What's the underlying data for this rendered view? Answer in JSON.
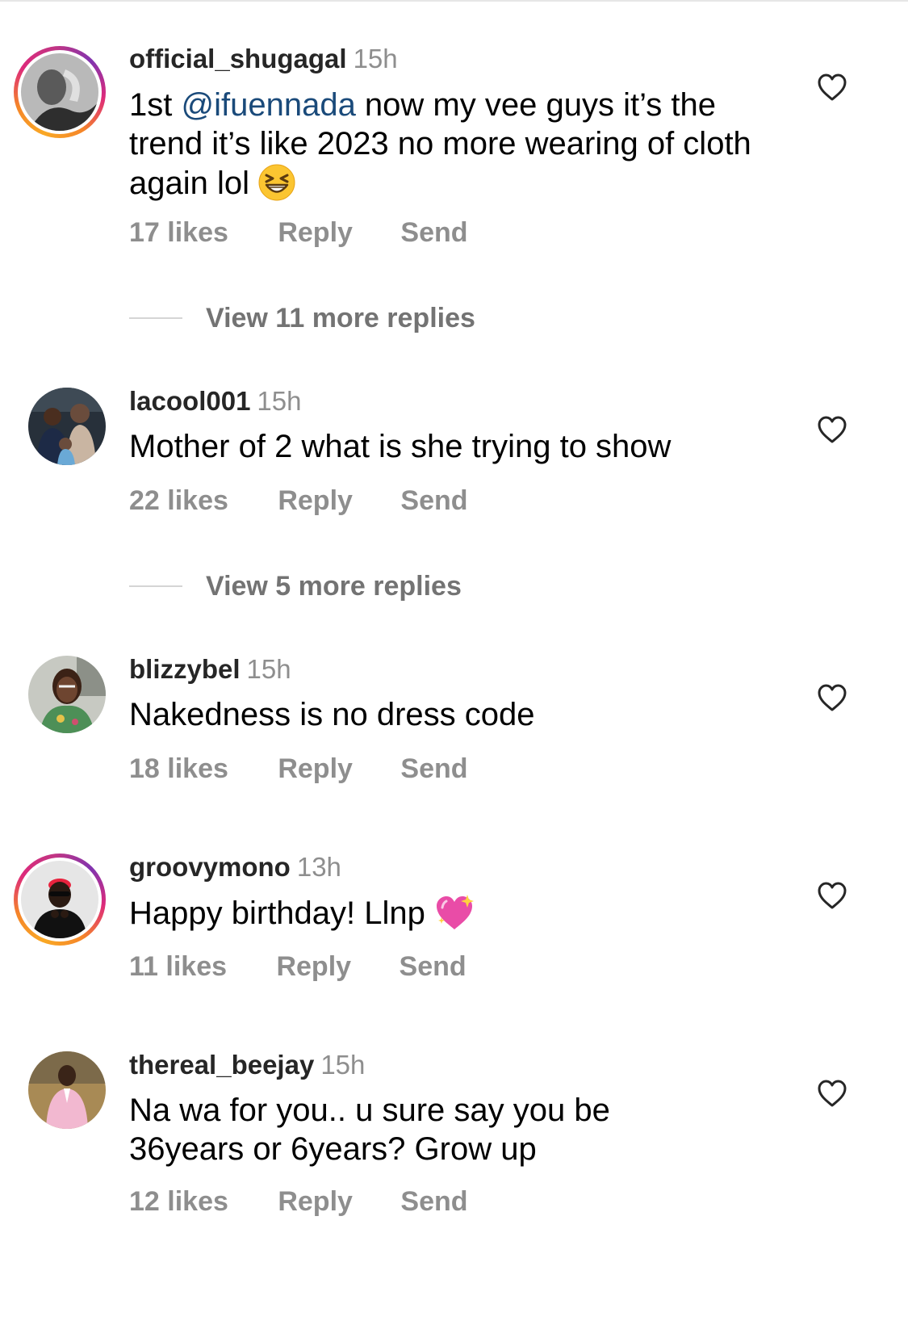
{
  "comments": [
    {
      "username": "official_shugagal",
      "time": "15h",
      "text_before": "1st ",
      "mention": "@ifuennada",
      "text_after": " now my vee guys it’s the trend it’s like 2023 no more wearing of cloth again lol",
      "emoji": "grinning-squinting-face-emoji",
      "likes": "17 likes",
      "reply": "Reply",
      "send": "Send",
      "view_more": "View 11 more replies"
    },
    {
      "username": "lacool001",
      "time": "15h",
      "text": "Mother of 2 what is she trying to show",
      "likes": "22 likes",
      "reply": "Reply",
      "send": "Send",
      "view_more": "View 5 more replies"
    },
    {
      "username": "blizzybel",
      "time": "15h",
      "text": "Nakedness is no dress code",
      "likes": "18 likes",
      "reply": "Reply",
      "send": "Send"
    },
    {
      "username": "groovymono",
      "time": "13h",
      "text": "Happy birthday! Llnp",
      "emoji": "sparkling-heart-emoji",
      "likes": "11 likes",
      "reply": "Reply",
      "send": "Send"
    },
    {
      "username": "thereal_beejay",
      "time": "15h",
      "text": "Na wa for you.. u sure say you be 36years or 6years? Grow up",
      "likes": "12 likes",
      "reply": "Reply",
      "send": "Send"
    }
  ],
  "icons": {
    "like": "heart-outline-icon"
  },
  "colors": {
    "mention": "#1a4a7a",
    "secondary_text": "#8e8e8e",
    "story_ring": "#dd2a7b"
  }
}
